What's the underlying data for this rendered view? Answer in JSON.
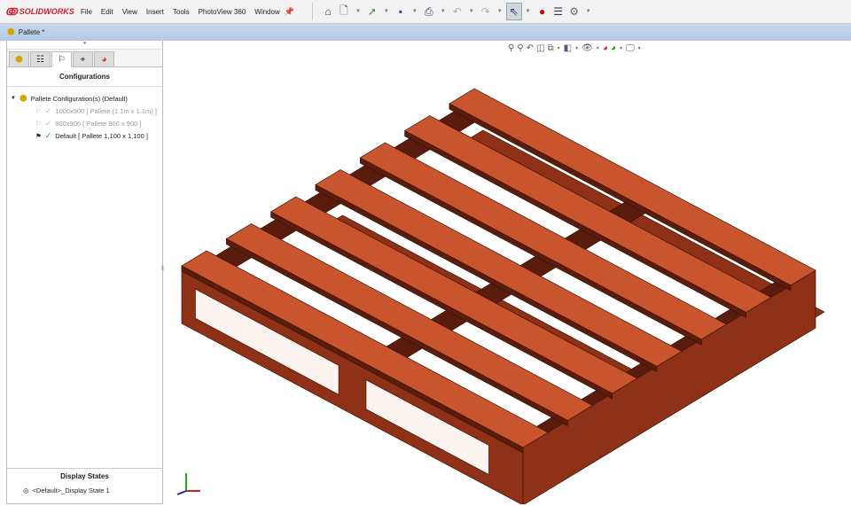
{
  "app": {
    "brand": "SOLIDWORKS",
    "menus": [
      "File",
      "Edit",
      "View",
      "Insert",
      "Tools",
      "PhotoView 360",
      "Window"
    ]
  },
  "toolbar": {
    "icons": [
      "home-icon",
      "new-document-icon",
      "open-icon",
      "save-icon",
      "print-icon",
      "undo-icon",
      "redo-icon",
      "select-icon",
      "traffic-light-icon",
      "file-properties-icon",
      "options-gear-icon"
    ]
  },
  "document": {
    "title": "Pallete *"
  },
  "panel": {
    "tabs": [
      "feature-manager",
      "property-manager",
      "configuration-manager",
      "dimxpert-manager",
      "display-manager"
    ],
    "active_tab": 2,
    "title": "Configurations",
    "root": "Pallete Configuration(s)  (Default)",
    "configs": [
      {
        "label": "1000x900 [ Pallete (1.1m x 1.1m) ]",
        "active": false
      },
      {
        "label": "900x900 [ Pallete 900 x 900 ]",
        "active": false
      },
      {
        "label": "Default [ Pallete 1,100 x 1,100 ]",
        "active": true
      }
    ],
    "display_states_title": "Display States",
    "display_state": "<Default>_Display State 1"
  },
  "colors": {
    "wood_top": "#c8552e",
    "wood_side": "#8e3116",
    "wood_dark": "#5a1c0c",
    "header": "#b8cde6"
  }
}
